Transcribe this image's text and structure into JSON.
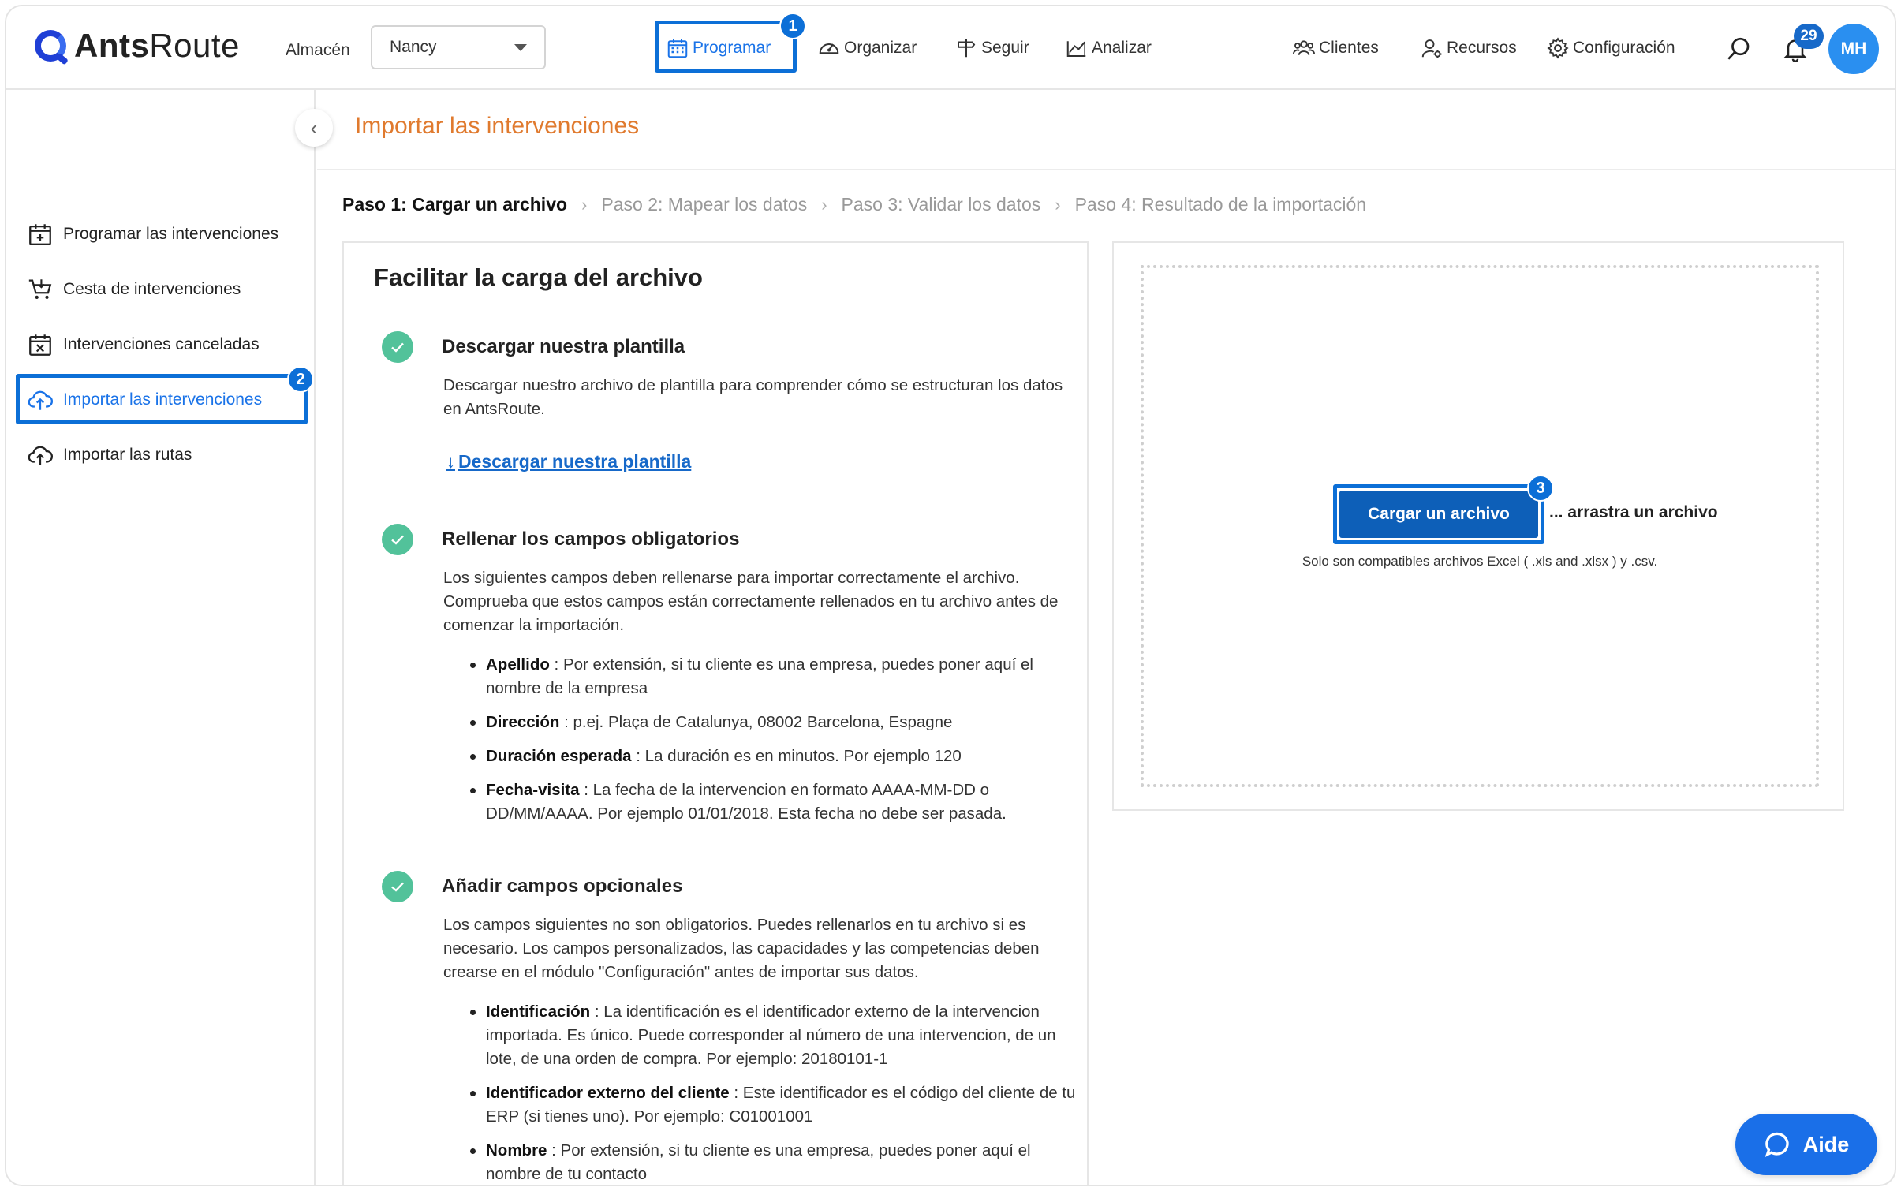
{
  "app": {
    "name_bold": "Ants",
    "name_rest": "Route"
  },
  "header": {
    "warehouse_label": "Almacén",
    "warehouse_value": "Nancy",
    "nav": {
      "schedule": "Programar",
      "organize": "Organizar",
      "track": "Seguir",
      "analyze": "Analizar",
      "clients": "Clientes",
      "resources": "Recursos",
      "settings": "Configuración"
    },
    "notification_count": "29",
    "avatar_initials": "MH"
  },
  "annotations": {
    "step1": "1",
    "step2": "2",
    "step3": "3"
  },
  "sidebar": {
    "items": [
      {
        "label": "Programar las intervenciones"
      },
      {
        "label": "Cesta de intervenciones"
      },
      {
        "label": "Intervenciones canceladas"
      },
      {
        "label": "Importar las intervenciones"
      },
      {
        "label": "Importar las rutas"
      }
    ]
  },
  "page": {
    "title": "Importar las intervenciones",
    "steps": [
      "Paso 1: Cargar un archivo",
      "Paso 2: Mapear los datos",
      "Paso 3: Validar los datos",
      "Paso 4: Resultado de la importación"
    ]
  },
  "guide": {
    "heading": "Facilitar la carga del archivo",
    "download": {
      "title": "Descargar nuestra plantilla",
      "text": "Descargar nuestro archivo de plantilla para comprender cómo se estructuran los datos en AntsRoute.",
      "link": "Descargar nuestra plantilla"
    },
    "required": {
      "title": "Rellenar los campos obligatorios",
      "text": "Los siguientes campos deben rellenarse para importar correctamente el archivo. Comprueba que estos campos están correctamente rellenados en tu archivo antes de comenzar la importación.",
      "fields": [
        {
          "name": "Apellido",
          "desc": " : Por extensión, si tu cliente es una empresa, puedes poner aquí el nombre de la empresa"
        },
        {
          "name": "Dirección",
          "desc": " : p.ej. Plaça de Catalunya, 08002 Barcelona, Espagne"
        },
        {
          "name": "Duración esperada",
          "desc": " : La duración es en minutos. Por ejemplo 120"
        },
        {
          "name": "Fecha-visita",
          "desc": " : La fecha de la intervencion en formato AAAA-MM-DD o DD/MM/AAAA. Por ejemplo 01/01/2018. Esta fecha no debe ser pasada."
        }
      ]
    },
    "optional": {
      "title": "Añadir campos opcionales",
      "text": "Los campos siguientes no son obligatorios. Puedes rellenarlos en tu archivo si es necesario. Los campos personalizados, las capacidades y las competencias deben crearse en el módulo \"Configuración\" antes de importar sus datos.",
      "fields": [
        {
          "name": "Identificación",
          "desc": " : La identificación es el identificador externo de la intervencion importada. Es único. Puede corresponder al número de una intervencion, de un lote, de una orden de compra. Por ejemplo: 20180101-1"
        },
        {
          "name": "Identificador externo del cliente",
          "desc": " : Este identificador es el código del cliente de tu ERP (si tienes uno). Por ejemplo: C01001001"
        },
        {
          "name": "Nombre",
          "desc": " : Por extensión, si tu cliente es una empresa, puedes poner aquí el nombre de tu contacto"
        }
      ]
    }
  },
  "upload": {
    "button": "Cargar un archivo",
    "drag_text": "... arrastra un archivo",
    "compat": "Solo son compatibles archivos Excel ( .xls and .xlsx ) y .csv."
  },
  "help": {
    "label": "Aide"
  },
  "colors": {
    "accent": "#1a73e8",
    "highlight": "#0c6fd7",
    "title": "#e07a2e",
    "check": "#52c29a"
  }
}
